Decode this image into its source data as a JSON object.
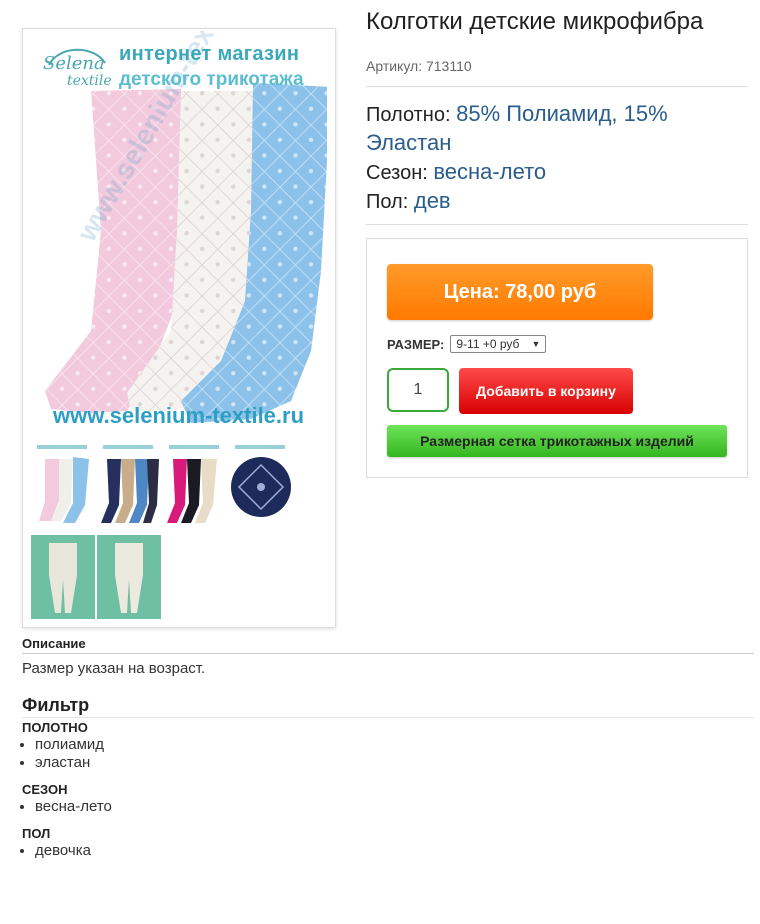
{
  "product": {
    "title": "Колготки детские микрофибра",
    "sku": "Артикул: 713110",
    "props": [
      {
        "label": "Полотно:",
        "value": "85% Полиамид, 15% Эластан"
      },
      {
        "label": "Сезон:",
        "value": "весна-лето"
      },
      {
        "label": "Пол:",
        "value": "дев"
      }
    ]
  },
  "image": {
    "brand_line1": "Selena",
    "brand_line2": "textile",
    "shop_line1": "интернет магазин",
    "shop_line2": "детского трикотажа",
    "url": "www.selenium-textile.ru",
    "watermark": "www.selenium-textile.ru"
  },
  "buy": {
    "price": "Цена: 78,00 руб",
    "size_label": "РАЗМЕР:",
    "size_value": "9-11 +0 руб",
    "quantity": "1",
    "add_to_cart": "Добавить в корзину",
    "size_chart": "Размерная сетка трикотажных изделий"
  },
  "description": {
    "heading": "Описание",
    "text": "Размер указан на возраст."
  },
  "filter": {
    "heading": "Фильтр",
    "groups": [
      {
        "title": "ПОЛОТНО",
        "items": [
          "полиамид",
          "эластан"
        ]
      },
      {
        "title": "СЕЗОН",
        "items": [
          "весна-лето"
        ]
      },
      {
        "title": "ПОЛ",
        "items": [
          "девочка"
        ]
      }
    ]
  },
  "colors": {
    "price_button": "#ff7a00",
    "cart_button": "#e01010",
    "size_chart_button": "#45c42e",
    "link_value": "#2a5c8c"
  }
}
